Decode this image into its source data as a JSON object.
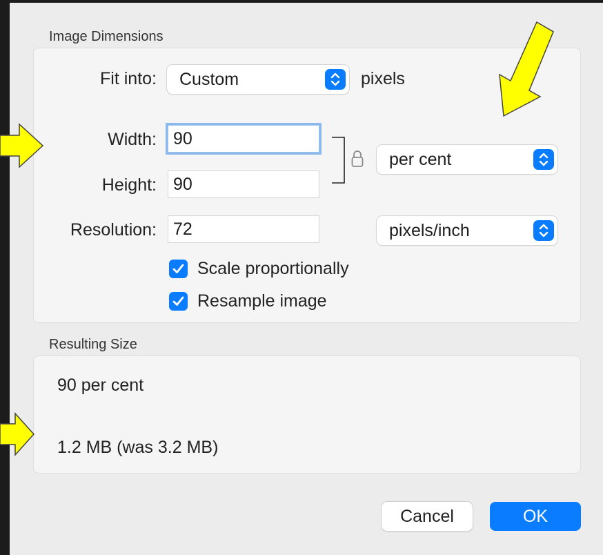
{
  "image_dimensions": {
    "section_title": "Image Dimensions",
    "fit_into": {
      "label": "Fit into:",
      "value": "Custom",
      "suffix": "pixels"
    },
    "width": {
      "label": "Width:",
      "value": "90"
    },
    "height": {
      "label": "Height:",
      "value": "90"
    },
    "unit": {
      "value": "per cent"
    },
    "resolution": {
      "label": "Resolution:",
      "value": "72",
      "unit": "pixels/inch"
    },
    "scale_proportionally": {
      "label": "Scale proportionally",
      "checked": true
    },
    "resample_image": {
      "label": "Resample image",
      "checked": true
    }
  },
  "resulting_size": {
    "section_title": "Resulting Size",
    "percent_text": "90 per cent",
    "size_text": "1.2 MB (was 3.2 MB)"
  },
  "buttons": {
    "cancel": "Cancel",
    "ok": "OK"
  },
  "colors": {
    "accent": "#0a7cff",
    "annotation_arrow": "#ffff00"
  },
  "icons": [
    "lock-icon",
    "up-down-chevron-icon",
    "checkmark-icon",
    "annotation-arrow-icon"
  ]
}
